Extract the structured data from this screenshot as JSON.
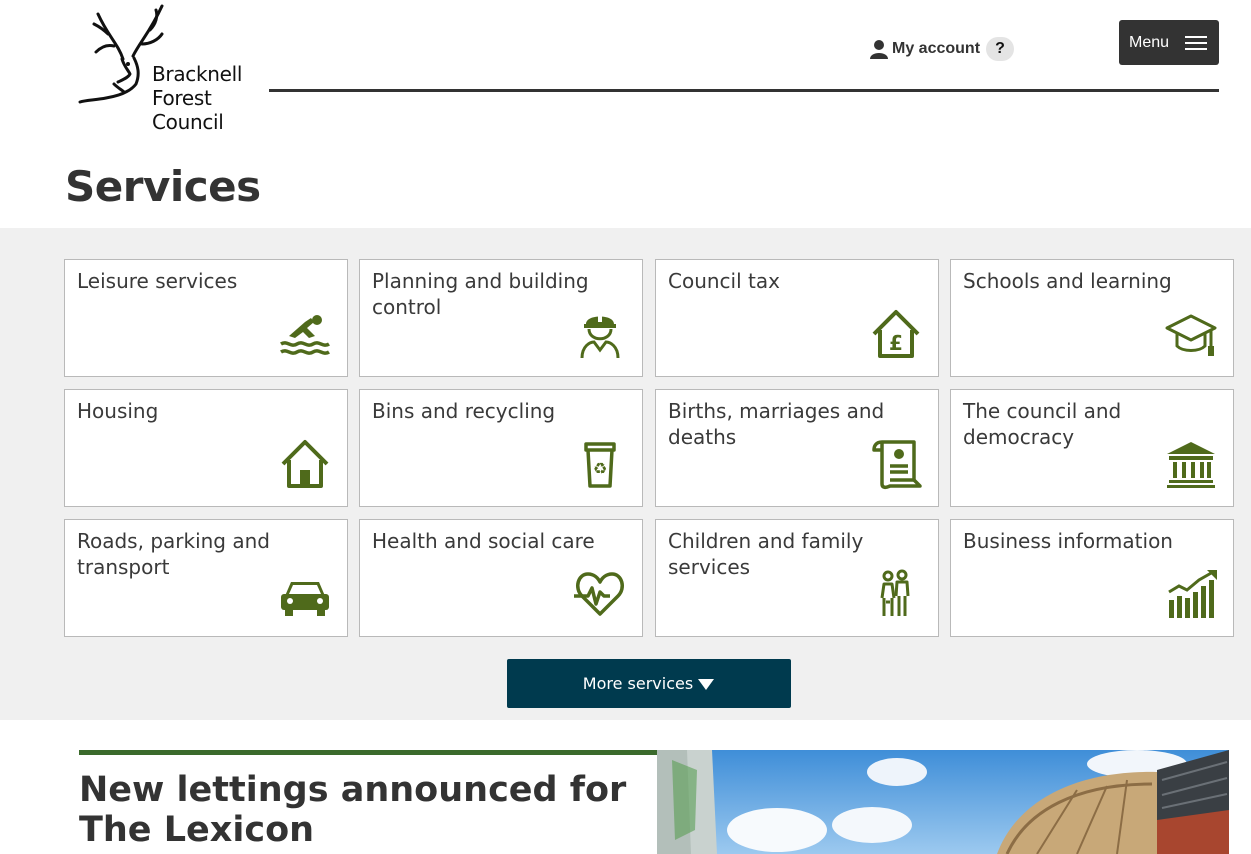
{
  "header": {
    "logo_text": "Bracknell\nForest\nCouncil",
    "account_label": "My account",
    "help_label": "?",
    "menu_label": "Menu"
  },
  "page_title": "Services",
  "colors": {
    "icon_green": "#4f6a1b",
    "button_navy": "#003a4e",
    "news_rule": "#3b6a2c",
    "section_bg": "#f0f0f0"
  },
  "services": [
    {
      "label": "Leisure services",
      "icon": "swimmer-icon"
    },
    {
      "label": "Planning and building control",
      "icon": "builder-icon"
    },
    {
      "label": "Council tax",
      "icon": "house-pound-icon"
    },
    {
      "label": "Schools and learning",
      "icon": "graduation-cap-icon"
    },
    {
      "label": "Housing",
      "icon": "house-icon"
    },
    {
      "label": "Bins and recycling",
      "icon": "recycling-bin-icon"
    },
    {
      "label": "Births, marriages and deaths",
      "icon": "certificate-scroll-icon"
    },
    {
      "label": "The council and democracy",
      "icon": "town-hall-icon"
    },
    {
      "label": "Roads, parking and transport",
      "icon": "car-icon"
    },
    {
      "label": "Health and social care",
      "icon": "heartbeat-icon"
    },
    {
      "label": "Children and family services",
      "icon": "family-icon"
    },
    {
      "label": "Business information",
      "icon": "growth-chart-icon"
    }
  ],
  "more_services_label": "More services",
  "news": {
    "title": "New lettings announced for The Lexicon"
  }
}
